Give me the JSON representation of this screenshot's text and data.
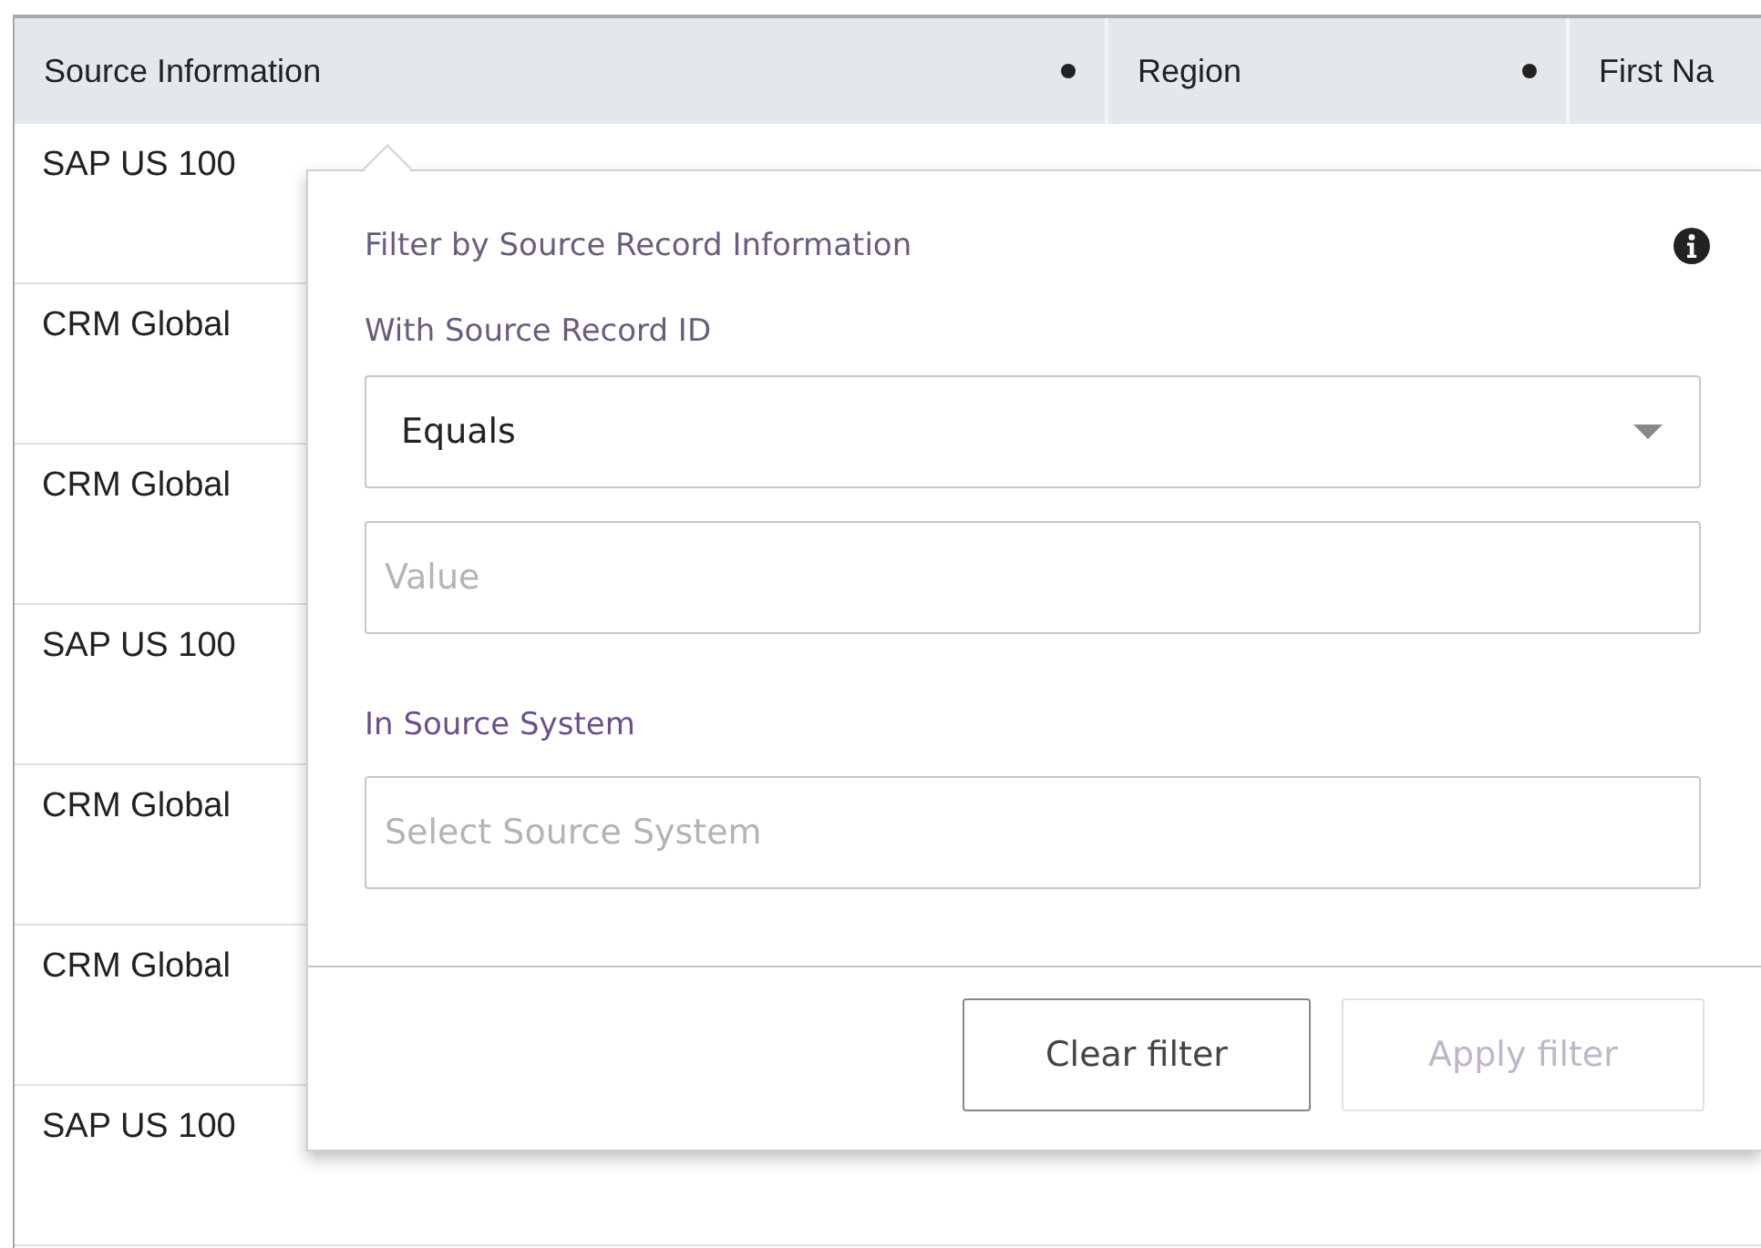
{
  "table": {
    "columns": [
      {
        "label": "Source Information"
      },
      {
        "label": "Region"
      },
      {
        "label": "First Na"
      }
    ],
    "rows": [
      {
        "source": "SAP US 100"
      },
      {
        "source": "CRM Global"
      },
      {
        "source": "CRM Global"
      },
      {
        "source": "SAP US 100"
      },
      {
        "source": "CRM Global"
      },
      {
        "source": "CRM Global"
      },
      {
        "source": "SAP US 100"
      }
    ]
  },
  "filter_popup": {
    "title": "Filter by Source Record Information",
    "record_label": "With Source Record ID",
    "operator": {
      "value": "Equals"
    },
    "value_field": {
      "placeholder": "Value"
    },
    "system_label": "In Source System",
    "system_field": {
      "placeholder": "Select Source System"
    },
    "buttons": [
      {
        "label": "Clear filter",
        "disabled": false
      },
      {
        "label": "Apply filter",
        "disabled": true
      }
    ]
  }
}
